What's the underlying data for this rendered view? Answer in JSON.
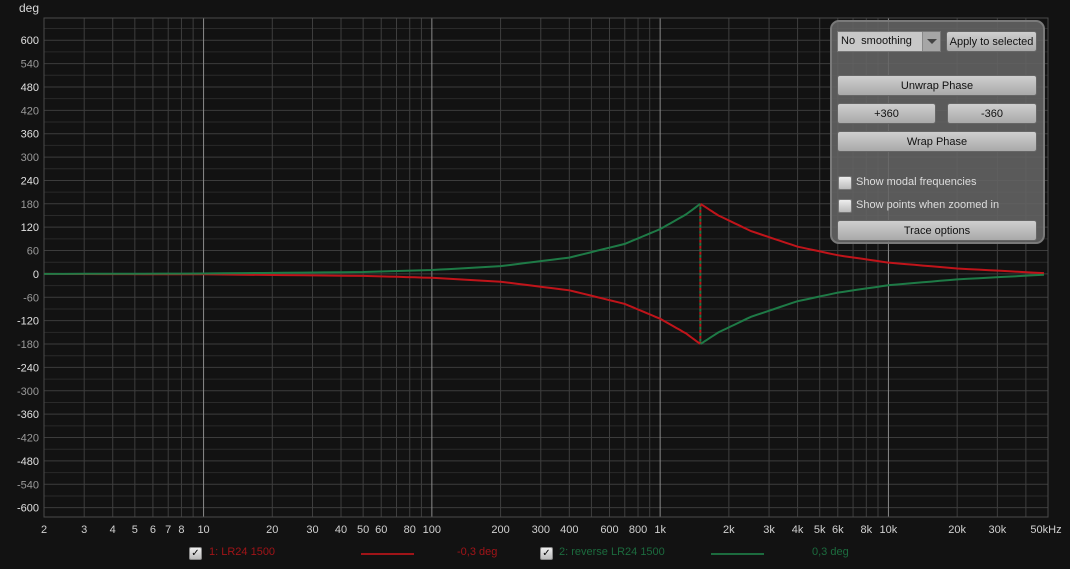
{
  "chart_data": {
    "type": "line",
    "title": "",
    "ylabel": "deg",
    "xlabel": "",
    "x_scale": "log",
    "xlim": [
      2,
      50000
    ],
    "ylim": [
      -624,
      657
    ],
    "grid": true,
    "y_ticks": [
      600,
      540,
      480,
      420,
      360,
      300,
      240,
      180,
      120,
      60,
      0,
      -60,
      -120,
      -180,
      -240,
      -300,
      -360,
      -420,
      -480,
      -540,
      -600
    ],
    "y_tick_labels": [
      "600",
      "540",
      "480",
      "420",
      "360",
      "300",
      "240",
      "180",
      "120",
      "60",
      "0",
      "-60",
      "-120",
      "-180",
      "-240",
      "-300",
      "-360",
      "-420",
      "-480",
      "-540",
      "-600"
    ],
    "x_ticks": [
      2,
      3,
      4,
      5,
      6,
      7,
      8,
      10,
      20,
      30,
      40,
      50,
      60,
      80,
      100,
      200,
      300,
      400,
      600,
      800,
      1000,
      2000,
      3000,
      4000,
      5000,
      6000,
      8000,
      10000,
      20000,
      30000,
      50000
    ],
    "x_tick_labels": [
      "2",
      "3",
      "4",
      "5",
      "6",
      "7",
      "8",
      "10",
      "20",
      "30",
      "40",
      "50",
      "60",
      "80",
      "100",
      "200",
      "300",
      "400",
      "600",
      "800",
      "1k",
      "2k",
      "3k",
      "4k",
      "5k",
      "6k",
      "8k",
      "10k",
      "20k",
      "30k",
      "50kHz"
    ],
    "series": [
      {
        "name": "1: LR24 1500",
        "color": "#c0141a",
        "x": [
          2,
          10,
          50,
          100,
          200,
          400,
          700,
          1000,
          1300,
          1500,
          1501,
          1800,
          2500,
          4000,
          6000,
          10000,
          20000,
          48000
        ],
        "y": [
          0,
          -1,
          -5,
          -10,
          -20,
          -42,
          -77,
          -115,
          -153,
          -180,
          180,
          150,
          110,
          70,
          48,
          29,
          14,
          2
        ]
      },
      {
        "name": "2: reverse LR24 1500",
        "color": "#1e7a46",
        "x": [
          2,
          10,
          50,
          100,
          200,
          400,
          700,
          1000,
          1300,
          1500,
          1501,
          1800,
          2500,
          4000,
          6000,
          10000,
          20000,
          48000
        ],
        "y": [
          0,
          1,
          5,
          10,
          20,
          42,
          77,
          115,
          153,
          180,
          -180,
          -150,
          -110,
          -70,
          -48,
          -29,
          -14,
          -2
        ]
      }
    ],
    "crossover_hz": 1500
  },
  "panel": {
    "smoothing_value": "No  smoothing",
    "apply_label": "Apply to selected",
    "unwrap_label": "Unwrap Phase",
    "plus360_label": "+360",
    "minus360_label": "-360",
    "wrap_label": "Wrap Phase",
    "modal_label": "Show modal frequencies",
    "modal_checked": false,
    "points_label": "Show points when zoomed in",
    "points_checked": false,
    "trace_options_label": "Trace options"
  },
  "legend": [
    {
      "checked": true,
      "check_glyph": "✓",
      "label": "1: LR24 1500",
      "value": "-0,3 deg",
      "color": "#c0141a"
    },
    {
      "checked": true,
      "check_glyph": "✓",
      "label": "2: reverse LR24 1500",
      "value": "0,3 deg",
      "color": "#1e7a46"
    }
  ]
}
